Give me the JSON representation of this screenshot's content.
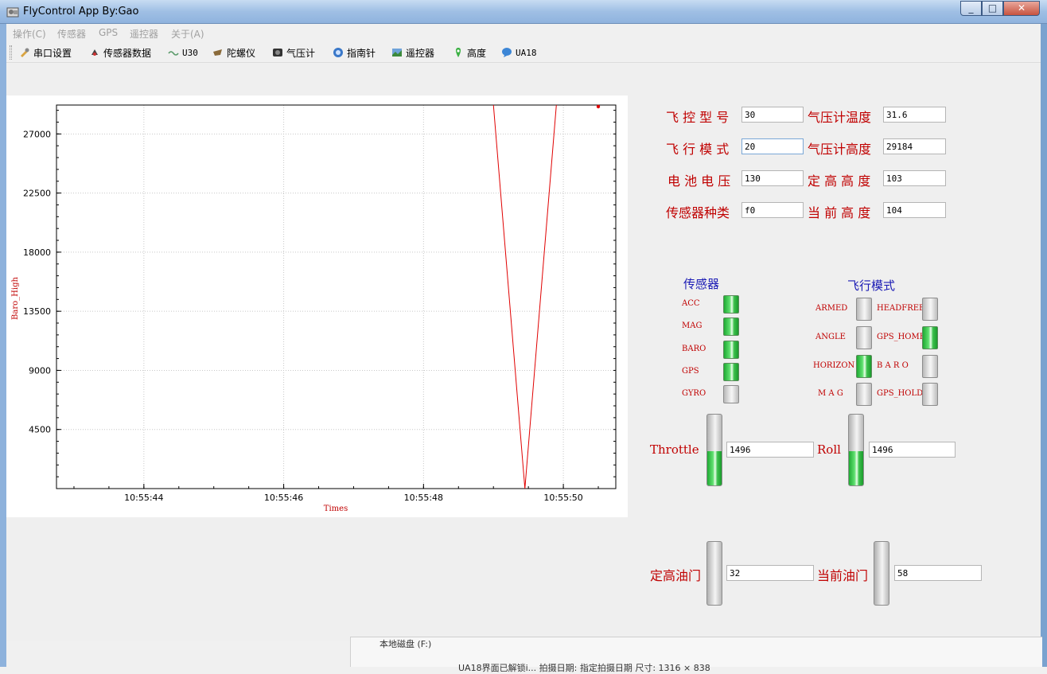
{
  "window": {
    "title": "FlyControl App By:Gao"
  },
  "menu": [
    "操作(C)",
    "传感器",
    "GPS",
    "遥控器",
    "关于(A)"
  ],
  "toolbar": [
    {
      "label": "串口设置",
      "icon": "serial-settings-icon"
    },
    {
      "label": "传感器数据",
      "icon": "sensor-data-icon"
    },
    {
      "label": "U30",
      "icon": "u30-icon"
    },
    {
      "label": "陀螺仪",
      "icon": "gyroscope-icon"
    },
    {
      "label": "气压计",
      "icon": "barometer-icon"
    },
    {
      "label": "指南针",
      "icon": "compass-icon"
    },
    {
      "label": "遥控器",
      "icon": "remote-control-icon"
    },
    {
      "label": "高度",
      "icon": "altitude-icon"
    },
    {
      "label": "UA18",
      "icon": "ua18-icon"
    }
  ],
  "chart_data": {
    "type": "line",
    "xlabel": "Times",
    "ylabel": "Baro_High",
    "x_ticks": [
      "10:55:44",
      "10:55:46",
      "10:55:48",
      "10:55:50"
    ],
    "y_ticks": [
      4500,
      9000,
      13500,
      18000,
      22500,
      27000
    ],
    "ylim": [
      0,
      29200
    ],
    "grid": true,
    "series": [
      {
        "color": "#e00000",
        "points": [
          [
            "10:55:49.0",
            29200
          ],
          [
            "10:55:49.45",
            0
          ],
          [
            "10:55:49.9",
            29200
          ]
        ]
      }
    ]
  },
  "info": {
    "fc_model_label": "飞 控 型 号",
    "fc_model": "30",
    "baro_temp_label": "气压计温度",
    "baro_temp": "31.6",
    "flight_mode_label": "飞 行 模 式",
    "flight_mode": "20",
    "baro_alt_label": "气压计高度",
    "baro_alt": "29184",
    "battery_label": "电 池 电 压",
    "battery": "130",
    "hold_alt_label": "定 高 高 度",
    "hold_alt": "103",
    "sensor_type_label": "传感器种类",
    "sensor_type": "f0",
    "cur_alt_label": "当 前 高 度",
    "cur_alt": "104"
  },
  "sensors": {
    "title": "传感器",
    "items": [
      {
        "label": "ACC",
        "on": true
      },
      {
        "label": "MAG",
        "on": true
      },
      {
        "label": "BARO",
        "on": true
      },
      {
        "label": "GPS",
        "on": true
      },
      {
        "label": "GYRO",
        "on": false
      }
    ]
  },
  "modes": {
    "title": "飞行模式",
    "left": [
      {
        "label": "ARMED",
        "on": false
      },
      {
        "label": "ANGLE",
        "on": false
      },
      {
        "label": "HORIZON",
        "on": true
      },
      {
        "label": "M A G",
        "on": false
      }
    ],
    "right": [
      {
        "label": "HEADFREE",
        "on": false
      },
      {
        "label": "GPS_HOME",
        "on": true
      },
      {
        "label": "B A R O",
        "on": false
      },
      {
        "label": "GPS_HOLD",
        "on": false
      }
    ]
  },
  "sticks": {
    "throttle_label": "Throttle",
    "throttle": "1496",
    "throttle_level": 0.48,
    "roll_label": "Roll",
    "roll": "1496",
    "roll_level": 0.48
  },
  "throttle_hold": {
    "hold_label": "定高油门",
    "hold_value": "32",
    "hold_level": 0,
    "current_label": "当前油门",
    "current_value": "58",
    "current_level": 0
  },
  "background_window": {
    "drive": "本地磁盘 (F:)",
    "status": "UA18界面已解锁i...    拍摄日期: 指定拍摄日期         尺寸: 1316 × 838"
  }
}
